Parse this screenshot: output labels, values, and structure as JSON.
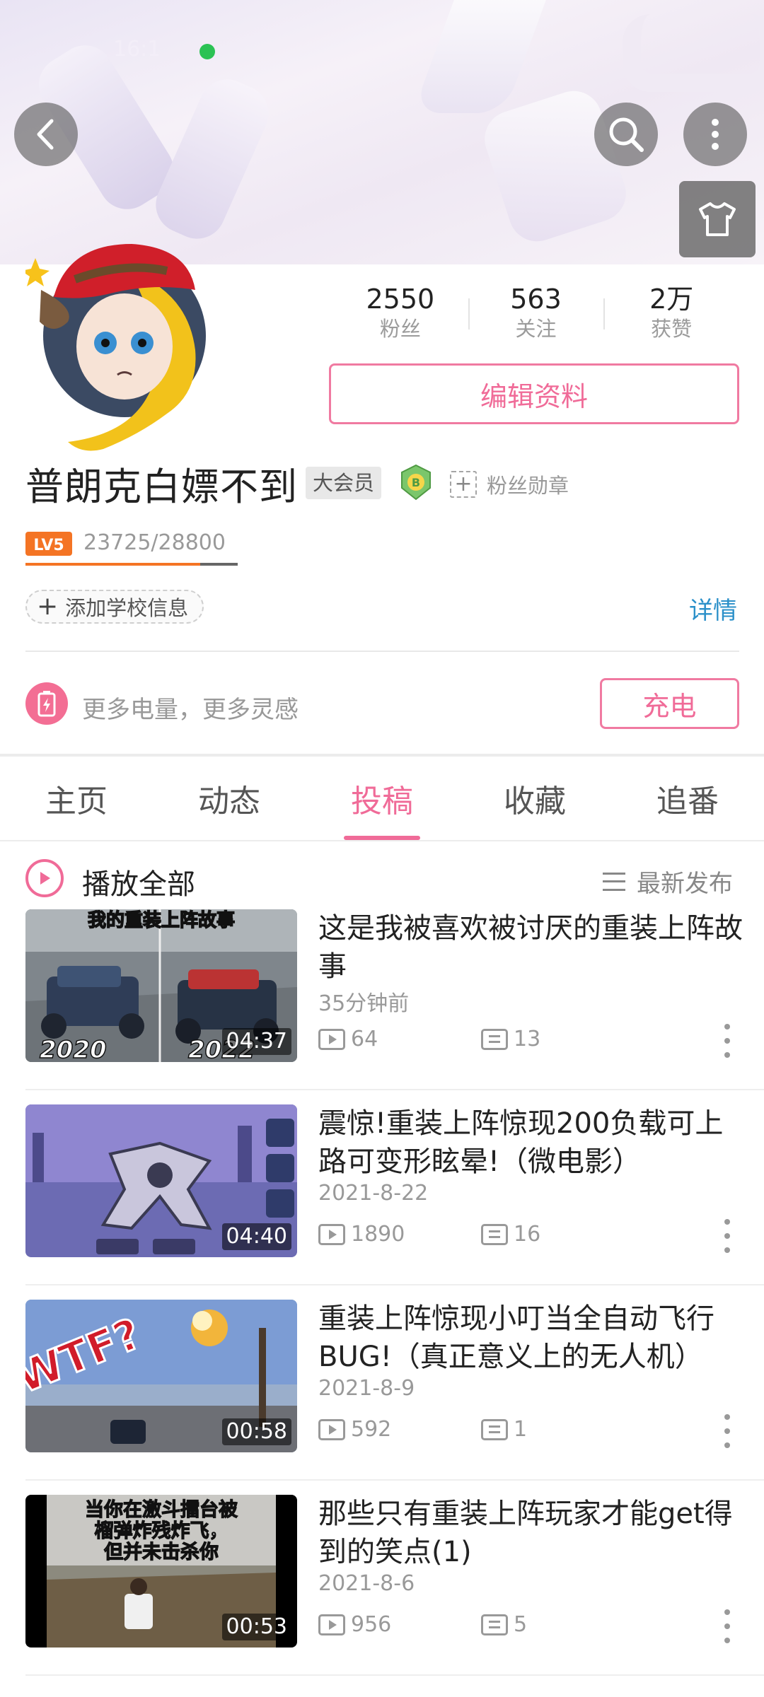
{
  "status_bar": {
    "time": "16:1"
  },
  "stats": [
    {
      "value": "2550",
      "label": "粉丝"
    },
    {
      "value": "563",
      "label": "关注"
    },
    {
      "value": "2万",
      "label": "获赞"
    }
  ],
  "profile": {
    "edit_label": "编辑资料",
    "name": "普朗克白嫖不到",
    "vip_badge": "大会员",
    "fans_medal_label": "粉丝勋章",
    "level_badge": "LV5",
    "level_progress": "23725/28800",
    "level_fraction": 0.824,
    "school_label": "添加学校信息",
    "details_label": "详情"
  },
  "charge": {
    "slogan": "更多电量，更多灵感",
    "button": "充电"
  },
  "tabs": [
    {
      "label": "主页",
      "active": false
    },
    {
      "label": "动态",
      "active": false
    },
    {
      "label": "投稿",
      "active": true
    },
    {
      "label": "收藏",
      "active": false
    },
    {
      "label": "追番",
      "active": false
    }
  ],
  "list_header": {
    "play_all": "播放全部",
    "sort": "最新发布"
  },
  "videos": [
    {
      "title": "这是我被喜欢被讨厌的重装上阵故事",
      "date": "35分钟前",
      "plays": "64",
      "comments": "13",
      "duration": "04:37",
      "thumb_text": [
        "我的重装上阵故事",
        "2020",
        "2022"
      ]
    },
    {
      "title": "震惊!重装上阵惊现200负载可上路可变形眩晕!（微电影）",
      "date": "2021-8-22",
      "plays": "1890",
      "comments": "16",
      "duration": "04:40"
    },
    {
      "title": "重装上阵惊现小叮当全自动飞行BUG!（真正意义上的无人机）",
      "date": "2021-8-9",
      "plays": "592",
      "comments": "1",
      "duration": "00:58",
      "thumb_text": [
        "WTF?"
      ]
    },
    {
      "title": "那些只有重装上阵玩家才能get得到的笑点(1)",
      "date": "2021-8-6",
      "plays": "956",
      "comments": "5",
      "duration": "00:53",
      "thumb_text": [
        "当你在激斗擂台被",
        "榴弹炸残炸飞，",
        "但并未击杀你"
      ]
    }
  ],
  "colors": {
    "accent_pink": "#f06b98",
    "link_blue": "#2b90c9",
    "level_orange": "#f47424"
  }
}
